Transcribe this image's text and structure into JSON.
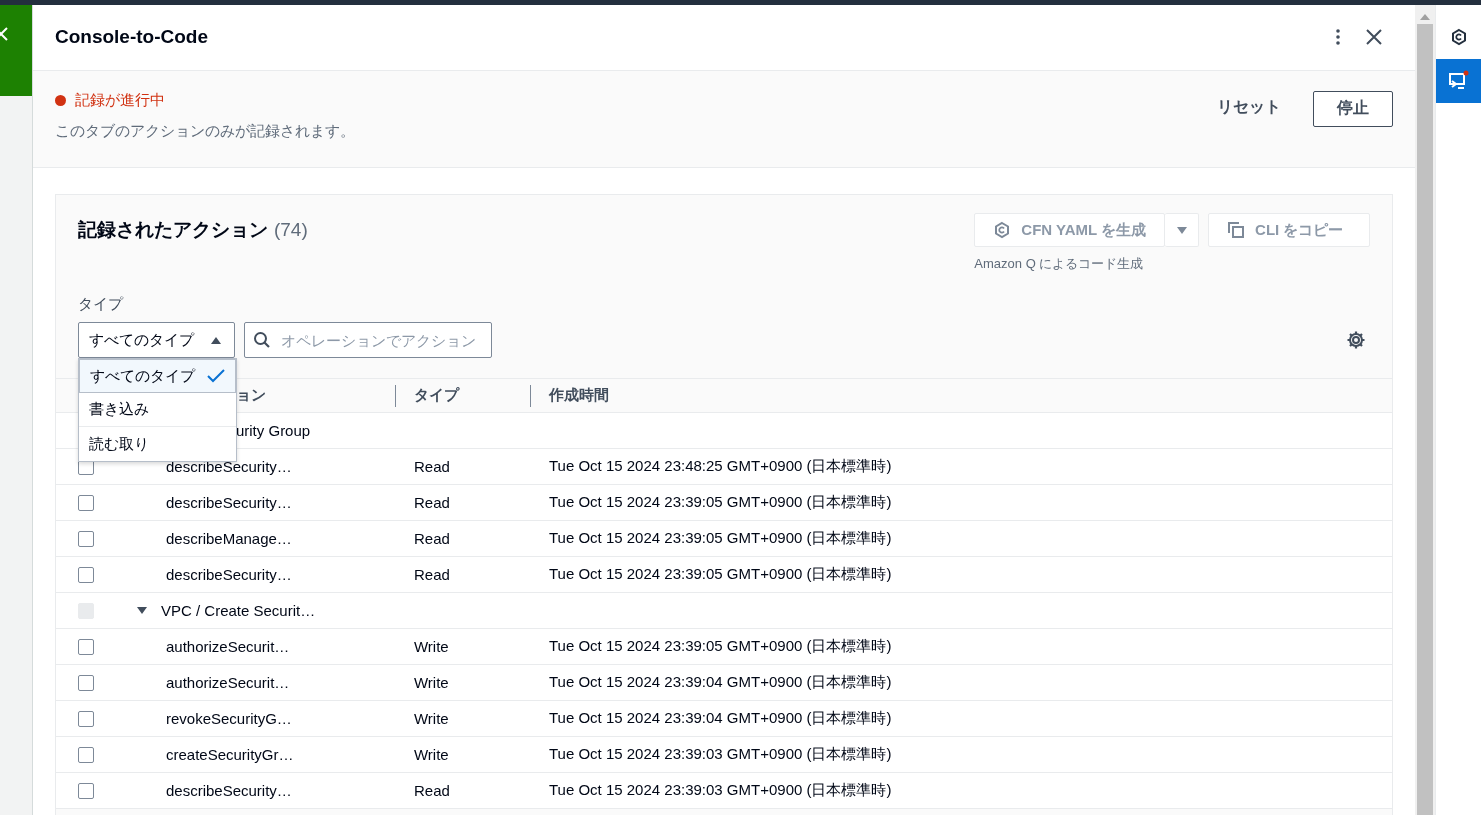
{
  "panel": {
    "title": "Console-to-Code"
  },
  "recording": {
    "status": "記録が進行中",
    "note": "このタブのアクションのみが記録されます。",
    "reset": "リセット",
    "stop": "停止"
  },
  "actions": {
    "title": "記録されたアクション",
    "count": "(74)",
    "generate": "CFN YAML を生成",
    "copy": "CLI をコピー",
    "generate_note": "Amazon Q によるコード生成",
    "filter_label": "タイプ",
    "type_select": {
      "value": "すべてのタイプ",
      "expanded": true,
      "options": [
        {
          "label": "すべてのタイプ",
          "selected": true
        },
        {
          "label": "書き込み",
          "selected": false
        },
        {
          "label": "読む取り",
          "selected": false
        }
      ]
    },
    "search": {
      "placeholder": "オペレーションでアクション"
    },
    "columns": [
      {
        "label": "ョン",
        "covered": true
      },
      {
        "label": "タイプ"
      },
      {
        "label": "作成時間"
      }
    ],
    "groups": [
      {
        "label": "urity Group",
        "covered": true,
        "expanded": true,
        "children": [
          {
            "name": "describeSecurity…",
            "type": "Read",
            "time": "Tue Oct 15 2024 23:48:25 GMT+0900 (日本標準時)",
            "checked": false
          },
          {
            "name": "describeSecurity…",
            "type": "Read",
            "time": "Tue Oct 15 2024 23:39:05 GMT+0900 (日本標準時)",
            "checked": false
          },
          {
            "name": "describeManage…",
            "type": "Read",
            "time": "Tue Oct 15 2024 23:39:05 GMT+0900 (日本標準時)",
            "checked": false
          },
          {
            "name": "describeSecurity…",
            "type": "Read",
            "time": "Tue Oct 15 2024 23:39:05 GMT+0900 (日本標準時)",
            "checked": false
          }
        ]
      },
      {
        "label": "VPC / Create Securit…",
        "covered": false,
        "expanded": true,
        "disabled": true,
        "children": [
          {
            "name": "authorizeSecurit…",
            "type": "Write",
            "time": "Tue Oct 15 2024 23:39:05 GMT+0900 (日本標準時)",
            "checked": false
          },
          {
            "name": "authorizeSecurit…",
            "type": "Write",
            "time": "Tue Oct 15 2024 23:39:04 GMT+0900 (日本標準時)",
            "checked": false
          },
          {
            "name": "revokeSecurityG…",
            "type": "Write",
            "time": "Tue Oct 15 2024 23:39:04 GMT+0900 (日本標準時)",
            "checked": false
          },
          {
            "name": "createSecurityGr…",
            "type": "Write",
            "time": "Tue Oct 15 2024 23:39:03 GMT+0900 (日本標準時)",
            "checked": false
          },
          {
            "name": "describeSecurity…",
            "type": "Read",
            "time": "Tue Oct 15 2024 23:39:03 GMT+0900 (日本標準時)",
            "checked": false
          }
        ]
      }
    ]
  }
}
